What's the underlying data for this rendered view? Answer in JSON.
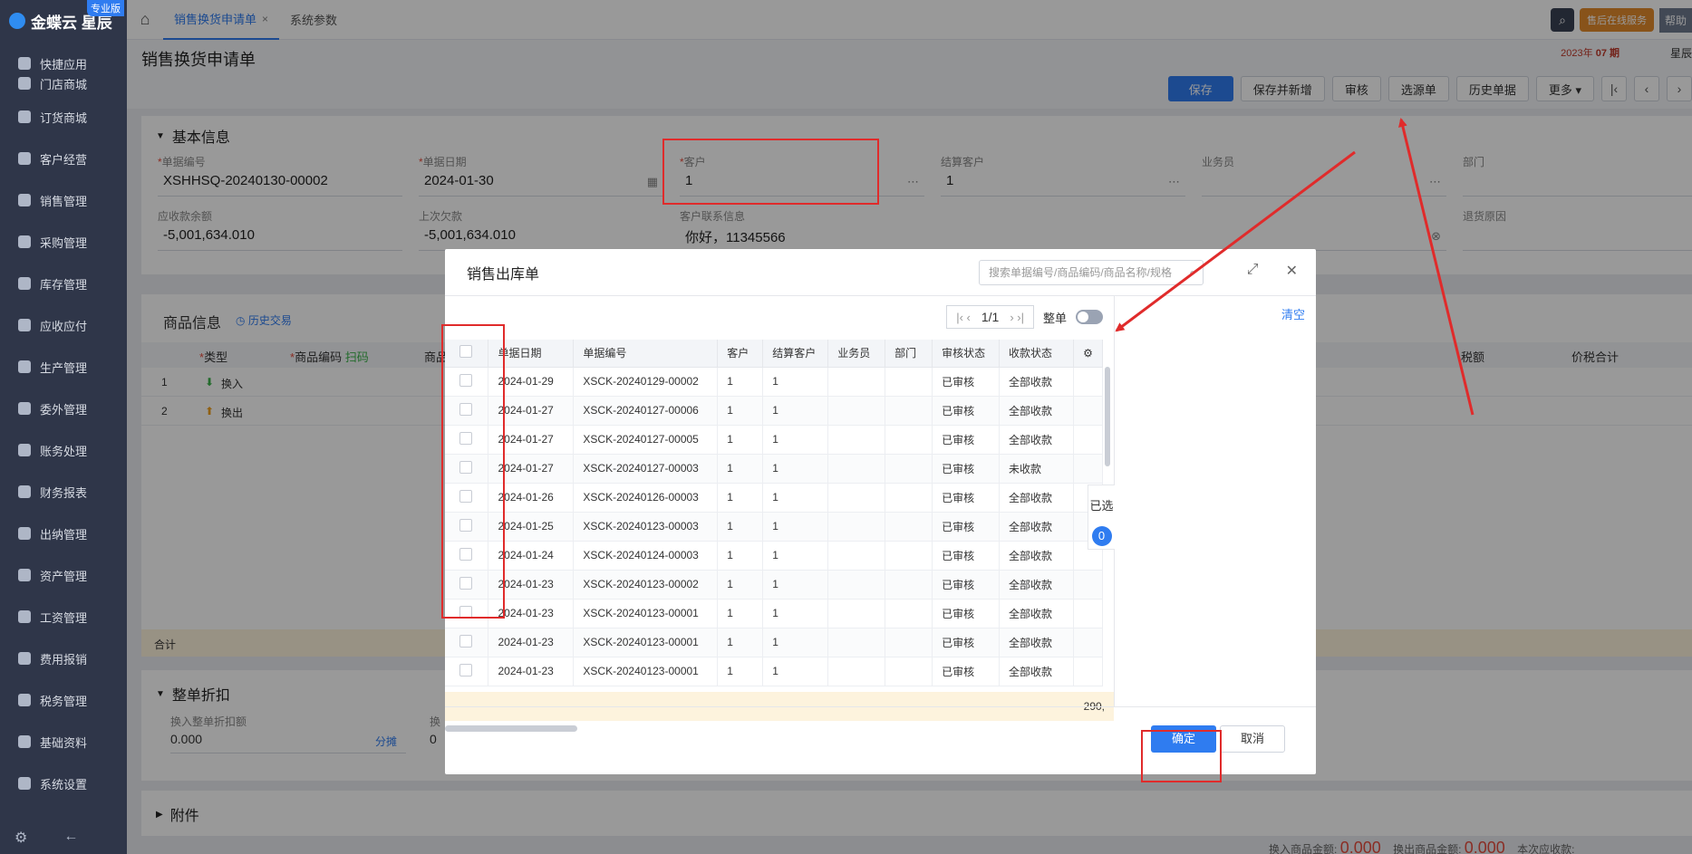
{
  "brand": {
    "name": "金蝶云 星辰",
    "badge": "专业版"
  },
  "sidebar": {
    "items": [
      {
        "label": "快捷应用"
      },
      {
        "label": "门店商城"
      },
      {
        "label": "订货商城"
      },
      {
        "label": "客户经营"
      },
      {
        "label": "销售管理"
      },
      {
        "label": "采购管理"
      },
      {
        "label": "库存管理"
      },
      {
        "label": "应收应付"
      },
      {
        "label": "生产管理"
      },
      {
        "label": "委外管理"
      },
      {
        "label": "账务处理"
      },
      {
        "label": "财务报表"
      },
      {
        "label": "出纳管理"
      },
      {
        "label": "资产管理"
      },
      {
        "label": "工资管理"
      },
      {
        "label": "费用报销"
      },
      {
        "label": "税务管理"
      },
      {
        "label": "基础资料"
      },
      {
        "label": "系统设置"
      }
    ]
  },
  "topbar": {
    "tabs": [
      {
        "label": "销售换货申请单",
        "close": "×"
      },
      {
        "label": "系统参数"
      }
    ],
    "service": "售后在线服务",
    "help": "帮助"
  },
  "page": {
    "title": "销售换货申请单",
    "date_year": "2023年",
    "date_period": "07 期",
    "user": "星辰"
  },
  "toolbar": {
    "save": "保存",
    "save_new": "保存并新增",
    "audit": "审核",
    "select_source": "选源单",
    "history": "历史单据",
    "more": "更多 ▾"
  },
  "basic": {
    "title": "基本信息",
    "fields": {
      "bill_no_label": "单据编号",
      "bill_no": "XSHHSQ-20240130-00002",
      "bill_date_label": "单据日期",
      "bill_date": "2024-01-30",
      "customer_label": "客户",
      "customer": "1",
      "settle_label": "结算客户",
      "settle": "1",
      "salesman_label": "业务员",
      "dept_label": "部门",
      "receivable_label": "应收款余额",
      "receivable": "-5,001,634.010",
      "last_debt_label": "上次欠款",
      "last_debt": "-5,001,634.010",
      "contact_label": "客户联系信息",
      "contact": "你好，11345566",
      "return_reason_label": "退货原因"
    }
  },
  "goods": {
    "title": "商品信息",
    "history": "历史交易",
    "headers": {
      "type": "类型",
      "code": "商品编码",
      "scan": "扫码",
      "name": "商品",
      "tax": "税额",
      "total": "价税合计"
    },
    "rows": [
      {
        "no": "1",
        "type": "换入"
      },
      {
        "no": "2",
        "type": "换出"
      }
    ],
    "sum_label": "合计"
  },
  "discount": {
    "title": "整单折扣",
    "in_label": "换入整单折扣额",
    "in_value": "0.000",
    "split": "分摊",
    "out_label": "换",
    "out_value": "0"
  },
  "attachment": {
    "title": "附件"
  },
  "footer_totals": {
    "in_label": "换入商品金额:",
    "in_value": "0.000",
    "out_label": "换出商品金额:",
    "out_value": "0.000",
    "this_label": "本次应收款:"
  },
  "modal": {
    "title": "销售出库单",
    "search_placeholder": "搜索单据编号/商品编码/商品名称/规格",
    "page": "1/1",
    "whole_label": "整单",
    "clear": "清空",
    "selected_label": "已选",
    "selected_count": "0",
    "sum_value": "290,",
    "columns": [
      "单据日期",
      "单据编号",
      "客户",
      "结算客户",
      "业务员",
      "部门",
      "审核状态",
      "收款状态"
    ],
    "rows": [
      {
        "date": "2024-01-29",
        "no": "XSCK-20240129-00002",
        "cust": "1",
        "settle": "1",
        "audit": "已审核",
        "pay": "全部收款",
        "pay_status": "ok"
      },
      {
        "date": "2024-01-27",
        "no": "XSCK-20240127-00006",
        "cust": "1",
        "settle": "1",
        "audit": "已审核",
        "pay": "全部收款",
        "pay_status": "ok"
      },
      {
        "date": "2024-01-27",
        "no": "XSCK-20240127-00005",
        "cust": "1",
        "settle": "1",
        "audit": "已审核",
        "pay": "全部收款",
        "pay_status": "ok"
      },
      {
        "date": "2024-01-27",
        "no": "XSCK-20240127-00003",
        "cust": "1",
        "settle": "1",
        "audit": "已审核",
        "pay": "未收款",
        "pay_status": "warn"
      },
      {
        "date": "2024-01-26",
        "no": "XSCK-20240126-00003",
        "cust": "1",
        "settle": "1",
        "audit": "已审核",
        "pay": "全部收款",
        "pay_status": "ok"
      },
      {
        "date": "2024-01-25",
        "no": "XSCK-20240123-00003",
        "cust": "1",
        "settle": "1",
        "audit": "已审核",
        "pay": "全部收款",
        "pay_status": "ok"
      },
      {
        "date": "2024-01-24",
        "no": "XSCK-20240124-00003",
        "cust": "1",
        "settle": "1",
        "audit": "已审核",
        "pay": "全部收款",
        "pay_status": "ok"
      },
      {
        "date": "2024-01-23",
        "no": "XSCK-20240123-00002",
        "cust": "1",
        "settle": "1",
        "audit": "已审核",
        "pay": "全部收款",
        "pay_status": "ok"
      },
      {
        "date": "2024-01-23",
        "no": "XSCK-20240123-00001",
        "cust": "1",
        "settle": "1",
        "audit": "已审核",
        "pay": "全部收款",
        "pay_status": "ok"
      },
      {
        "date": "2024-01-23",
        "no": "XSCK-20240123-00001",
        "cust": "1",
        "settle": "1",
        "audit": "已审核",
        "pay": "全部收款",
        "pay_status": "ok"
      },
      {
        "date": "2024-01-23",
        "no": "XSCK-20240123-00001",
        "cust": "1",
        "settle": "1",
        "audit": "已审核",
        "pay": "全部收款",
        "pay_status": "ok"
      }
    ],
    "ok": "确定",
    "cancel": "取消"
  },
  "colors": {
    "accent": "#2f7cf0",
    "annotation": "#e02b2b",
    "ok": "#3bb34a",
    "warn": "#f0821e"
  }
}
